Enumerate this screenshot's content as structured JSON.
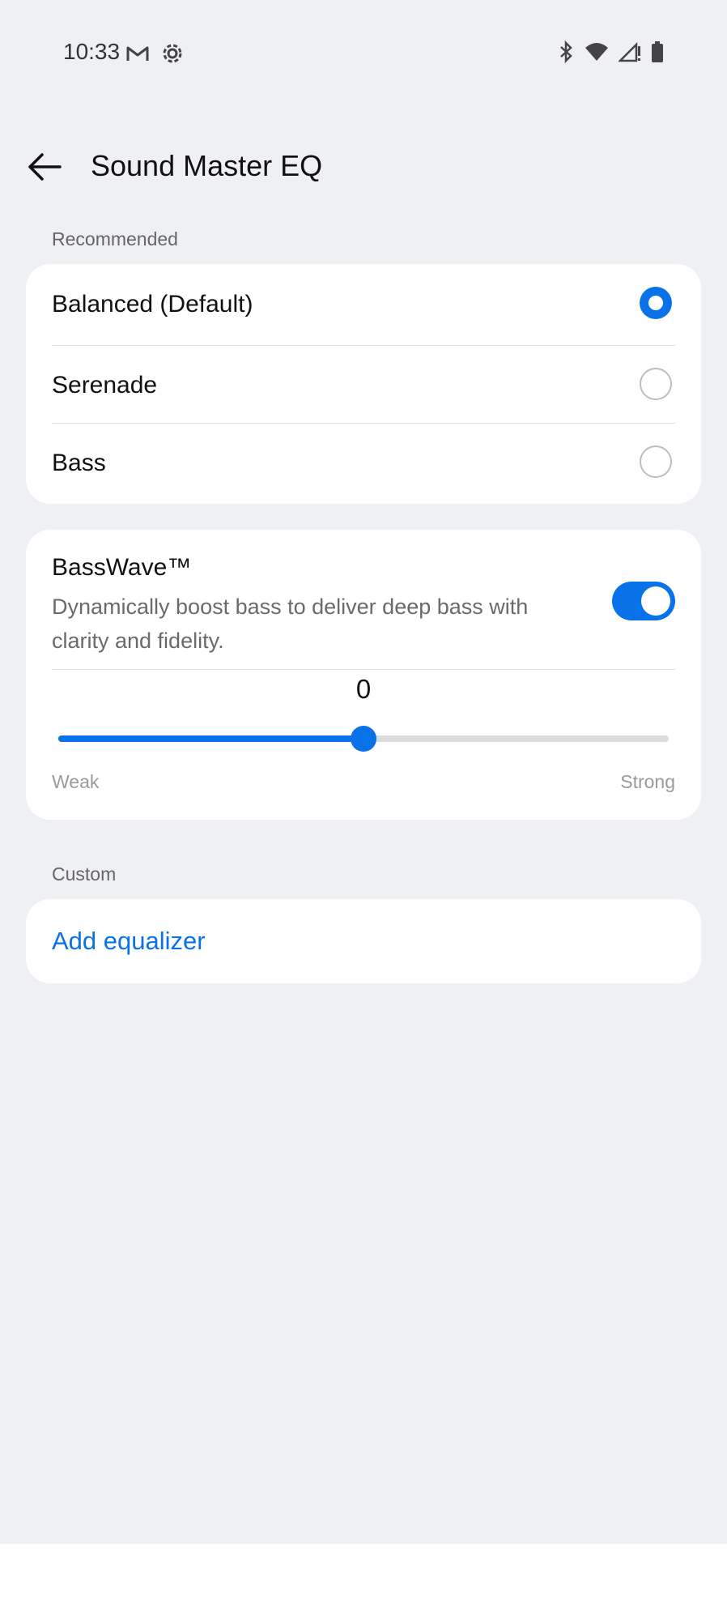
{
  "status_bar": {
    "time": "10:33",
    "left_icons": [
      "gmail-icon",
      "settings-gear-icon"
    ],
    "right_icons": [
      "bluetooth-icon",
      "wifi-icon",
      "signal-icon",
      "battery-icon"
    ]
  },
  "app_bar": {
    "title": "Sound Master EQ",
    "back_icon": "arrow-left-icon"
  },
  "recommended": {
    "label": "Recommended",
    "options": [
      {
        "label": "Balanced (Default)",
        "selected": true
      },
      {
        "label": "Serenade",
        "selected": false
      },
      {
        "label": "Bass",
        "selected": false
      }
    ]
  },
  "basswave": {
    "title": "BassWave™",
    "description": "Dynamically boost bass to deliver deep bass with clarity and fidelity.",
    "enabled": true,
    "slider": {
      "value": "0",
      "level": 0.5,
      "min_label": "Weak",
      "max_label": "Strong"
    }
  },
  "custom": {
    "label": "Custom",
    "add_label": "Add equalizer"
  },
  "colors": {
    "accent": "#0a72e8",
    "background": "#eef0f3",
    "card": "#ffffff"
  }
}
